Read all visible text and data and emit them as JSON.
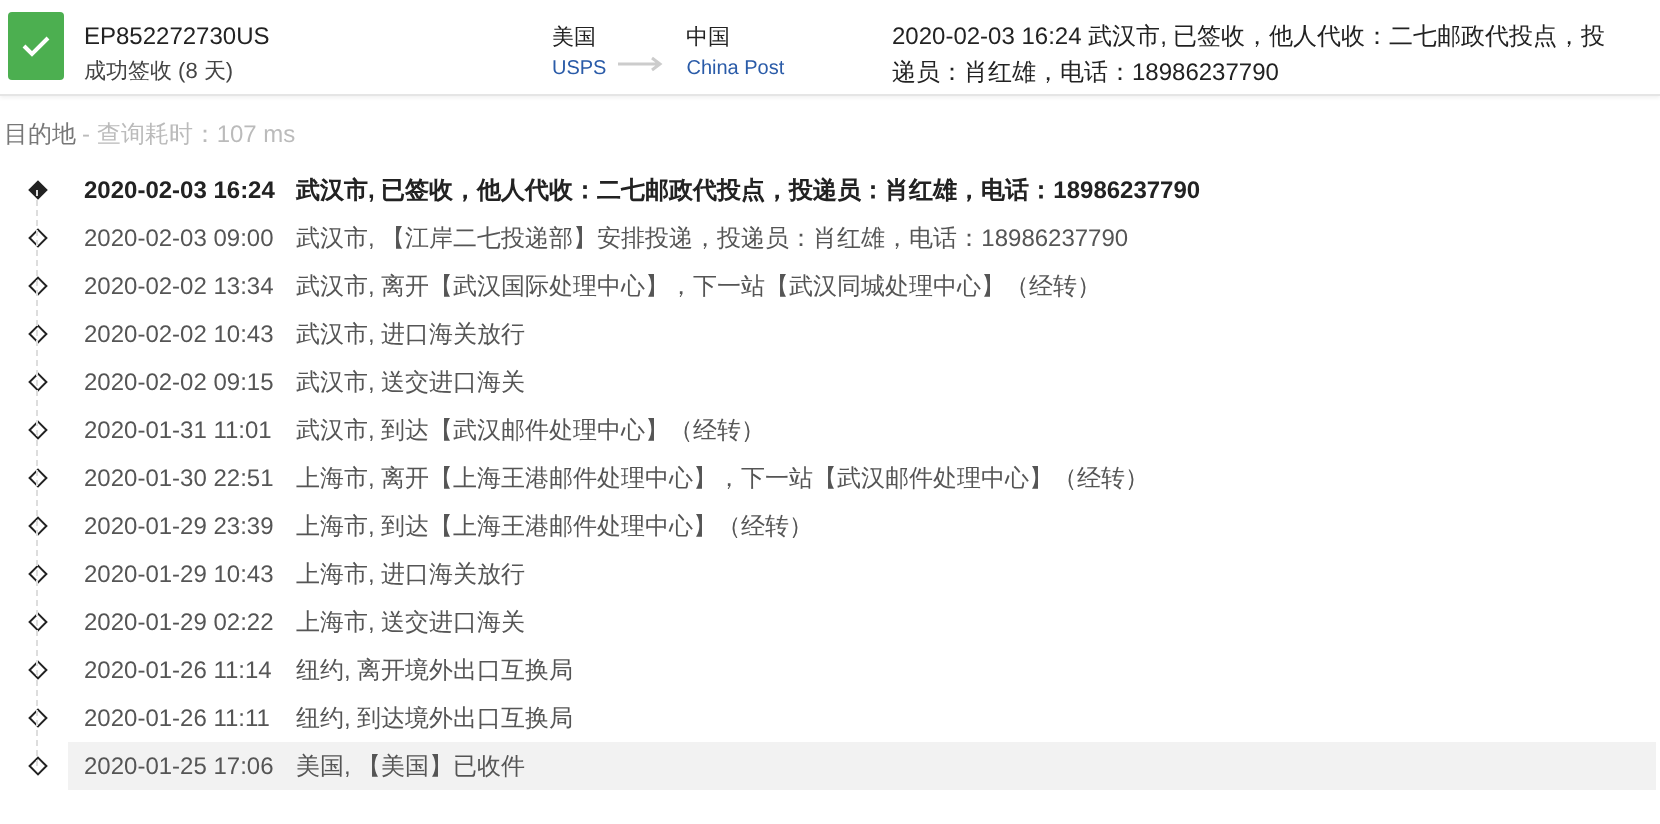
{
  "shipment": {
    "kind": "delivered",
    "tracking_number": "EP852272730US",
    "status_text": "成功签收 (8 天)",
    "origin": {
      "country": "美国",
      "carrier": "USPS"
    },
    "destination": {
      "country": "中国",
      "carrier": "China Post"
    },
    "latest_event": "2020-02-03 16:24  武汉市, 已签收，他人代收：二七邮政代投点，投递员：肖红雄，电话：18986237790"
  },
  "section": {
    "title": "目的地",
    "query_time": "- 查询耗时：107 ms"
  },
  "events": [
    {
      "time": "2020-02-03 16:24",
      "text": "武汉市, 已签收，他人代收：二七邮政代投点，投递员：肖红雄，电话：18986237790",
      "latest": true,
      "selected": false
    },
    {
      "time": "2020-02-03 09:00",
      "text": "武汉市, 【江岸二七投递部】安排投递，投递员：肖红雄，电话：18986237790",
      "latest": false,
      "selected": false
    },
    {
      "time": "2020-02-02 13:34",
      "text": "武汉市, 离开【武汉国际处理中心】，下一站【武汉同城处理中心】（经转）",
      "latest": false,
      "selected": false
    },
    {
      "time": "2020-02-02 10:43",
      "text": "武汉市, 进口海关放行",
      "latest": false,
      "selected": false
    },
    {
      "time": "2020-02-02 09:15",
      "text": "武汉市, 送交进口海关",
      "latest": false,
      "selected": false
    },
    {
      "time": "2020-01-31 11:01",
      "text": "武汉市, 到达【武汉邮件处理中心】（经转）",
      "latest": false,
      "selected": false
    },
    {
      "time": "2020-01-30 22:51",
      "text": "上海市, 离开【上海王港邮件处理中心】，下一站【武汉邮件处理中心】（经转）",
      "latest": false,
      "selected": false
    },
    {
      "time": "2020-01-29 23:39",
      "text": "上海市, 到达【上海王港邮件处理中心】（经转）",
      "latest": false,
      "selected": false
    },
    {
      "time": "2020-01-29 10:43",
      "text": "上海市, 进口海关放行",
      "latest": false,
      "selected": false
    },
    {
      "time": "2020-01-29 02:22",
      "text": "上海市, 送交进口海关",
      "latest": false,
      "selected": false
    },
    {
      "time": "2020-01-26 11:14",
      "text": "纽约, 离开境外出口互换局",
      "latest": false,
      "selected": false
    },
    {
      "time": "2020-01-26 11:11",
      "text": "纽约, 到达境外出口互换局",
      "latest": false,
      "selected": false
    },
    {
      "time": "2020-01-25 17:06",
      "text": "美国, 【美国】已收件",
      "latest": false,
      "selected": true
    }
  ]
}
